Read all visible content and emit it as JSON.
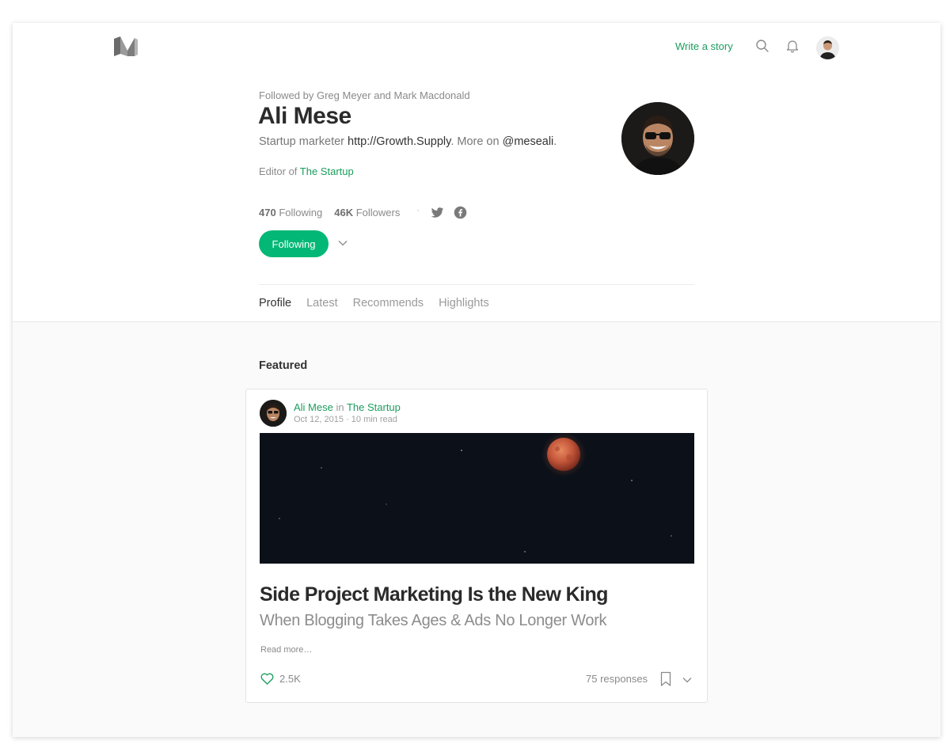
{
  "nav": {
    "logo_icon": "medium-logo-icon",
    "write_label": "Write a story",
    "search_icon": "search-icon",
    "bell_icon": "bell-icon",
    "avatar_icon": "user-avatar"
  },
  "profile": {
    "followed_by": "Followed by Greg Meyer and Mark Macdonald",
    "name": "Ali Mese",
    "bio_prefix": "Startup marketer ",
    "bio_link": "http://Growth.Supply",
    "bio_middle": ". More on ",
    "bio_handle": "@meseali",
    "bio_suffix": ".",
    "editor_prefix": "Editor of ",
    "editor_pub": "The Startup",
    "following_count": "470",
    "following_label": " Following",
    "followers_count": "46K",
    "followers_label": " Followers",
    "dot": "·",
    "follow_button": "Following"
  },
  "tabs": [
    {
      "label": "Profile",
      "active": true
    },
    {
      "label": "Latest",
      "active": false
    },
    {
      "label": "Recommends",
      "active": false
    },
    {
      "label": "Highlights",
      "active": false
    }
  ],
  "featured": {
    "section_label": "Featured",
    "author": "Ali Mese",
    "in_word": " in ",
    "publication": "The Startup",
    "date": "Oct 12, 2015",
    "meta_sep": " · ",
    "read_time": "10 min read",
    "title": "Side Project Marketing Is the New King",
    "subtitle": "When Blogging Takes Ages & Ads No Longer Work",
    "read_more": "Read more…",
    "likes": "2.5K",
    "responses": "75 responses"
  },
  "colors": {
    "accent": "#1a9d5c",
    "button": "#03b876",
    "moon": "#c4573a"
  }
}
